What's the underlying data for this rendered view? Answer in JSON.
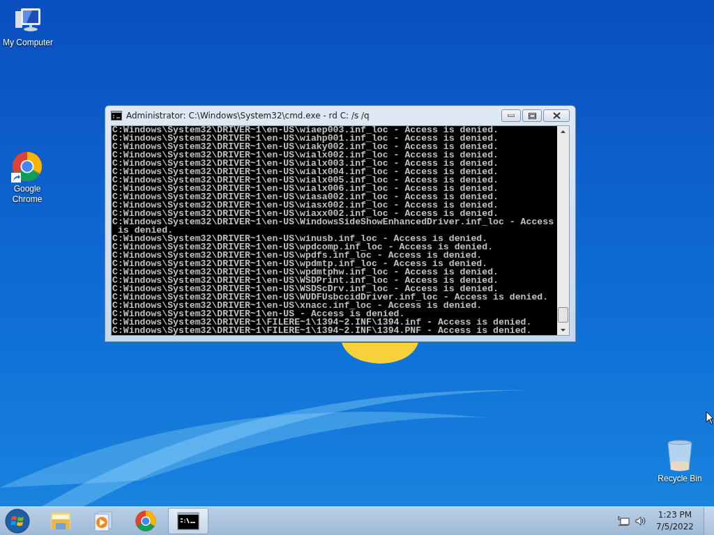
{
  "desktop_icons": [
    {
      "kind": "computer",
      "label": "My Computer"
    },
    {
      "kind": "chrome",
      "label": "Google Chrome",
      "shortcut": true
    },
    {
      "kind": "recycle",
      "label": "Recycle Bin"
    }
  ],
  "window": {
    "title": "Administrator: C:\\Windows\\System32\\cmd.exe - rd  C: /s /q",
    "console_lines": [
      "C:Windows\\System32\\DRIVER~1\\en-US\\wiaep003.inf_loc - Access is denied.",
      "C:Windows\\System32\\DRIVER~1\\en-US\\wiahp001.inf_loc - Access is denied.",
      "C:Windows\\System32\\DRIVER~1\\en-US\\wiaky002.inf_loc - Access is denied.",
      "C:Windows\\System32\\DRIVER~1\\en-US\\wialx002.inf_loc - Access is denied.",
      "C:Windows\\System32\\DRIVER~1\\en-US\\wialx003.inf_loc - Access is denied.",
      "C:Windows\\System32\\DRIVER~1\\en-US\\wialx004.inf_loc - Access is denied.",
      "C:Windows\\System32\\DRIVER~1\\en-US\\wialx005.inf_loc - Access is denied.",
      "C:Windows\\System32\\DRIVER~1\\en-US\\wialx006.inf_loc - Access is denied.",
      "C:Windows\\System32\\DRIVER~1\\en-US\\wiasa002.inf_loc - Access is denied.",
      "C:Windows\\System32\\DRIVER~1\\en-US\\wiasx002.inf_loc - Access is denied.",
      "C:Windows\\System32\\DRIVER~1\\en-US\\wiaxx002.inf_loc - Access is denied.",
      "C:Windows\\System32\\DRIVER~1\\en-US\\WindowsSideShowEnhancedDriver.inf_loc - Access",
      " is denied.",
      "C:Windows\\System32\\DRIVER~1\\en-US\\winusb.inf_loc - Access is denied.",
      "C:Windows\\System32\\DRIVER~1\\en-US\\wpdcomp.inf_loc - Access is denied.",
      "C:Windows\\System32\\DRIVER~1\\en-US\\wpdfs.inf_loc - Access is denied.",
      "C:Windows\\System32\\DRIVER~1\\en-US\\wpdmtp.inf_loc - Access is denied.",
      "C:Windows\\System32\\DRIVER~1\\en-US\\wpdmtphw.inf_loc - Access is denied.",
      "C:Windows\\System32\\DRIVER~1\\en-US\\WSDPrint.inf_loc - Access is denied.",
      "C:Windows\\System32\\DRIVER~1\\en-US\\WSDScDrv.inf_loc - Access is denied.",
      "C:Windows\\System32\\DRIVER~1\\en-US\\WUDFUsbccidDriver.inf_loc - Access is denied.",
      "C:Windows\\System32\\DRIVER~1\\en-US\\xnacc.inf_loc - Access is denied.",
      "C:Windows\\System32\\DRIVER~1\\en-US - Access is denied.",
      "C:Windows\\System32\\DRIVER~1\\FILERE~1\\1394~2.INF\\1394.inf - Access is denied.",
      "C:Windows\\System32\\DRIVER~1\\FILERE~1\\1394~2.INF\\1394.PNF - Access is denied."
    ]
  },
  "taskbar": {
    "items": [
      {
        "kind": "explorer",
        "selected": false
      },
      {
        "kind": "media",
        "selected": false
      },
      {
        "kind": "chrome",
        "selected": false
      },
      {
        "kind": "cmd",
        "selected": true
      }
    ],
    "clock": {
      "time": "1:23 PM",
      "date": "7/5/2022"
    }
  }
}
